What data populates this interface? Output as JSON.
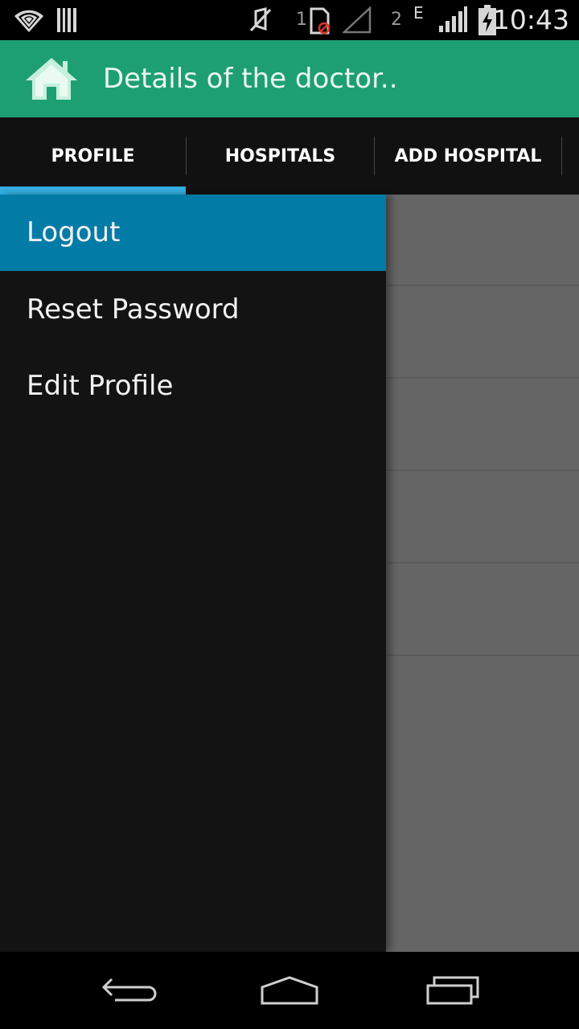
{
  "status_bar": {
    "sim1_label": "1",
    "sim2_label": "2",
    "network_type": "E",
    "time": "10:43",
    "icons": [
      "wifi-icon",
      "barcode-icon",
      "mute-icon",
      "sim-card-icon",
      "signal-empty-icon",
      "signal-icon",
      "battery-charging-icon"
    ]
  },
  "action_bar": {
    "title": "Details of the doctor..",
    "icon": "home-icon",
    "background": "#1e9f73"
  },
  "tabs": [
    {
      "label": "PROFILE",
      "selected": true
    },
    {
      "label": "HOSPITALS",
      "selected": false
    },
    {
      "label": "ADD HOSPITAL",
      "selected": false
    }
  ],
  "drawer": {
    "items": [
      {
        "label": "Logout",
        "active": true
      },
      {
        "label": "Reset Password",
        "active": false
      },
      {
        "label": "Edit Profile",
        "active": false
      }
    ],
    "active_color": "#027ca6"
  },
  "nav_bar": {
    "icons": [
      "back-icon",
      "home-nav-icon",
      "recents-icon"
    ]
  },
  "colors": {
    "accent": "#33aee0"
  }
}
